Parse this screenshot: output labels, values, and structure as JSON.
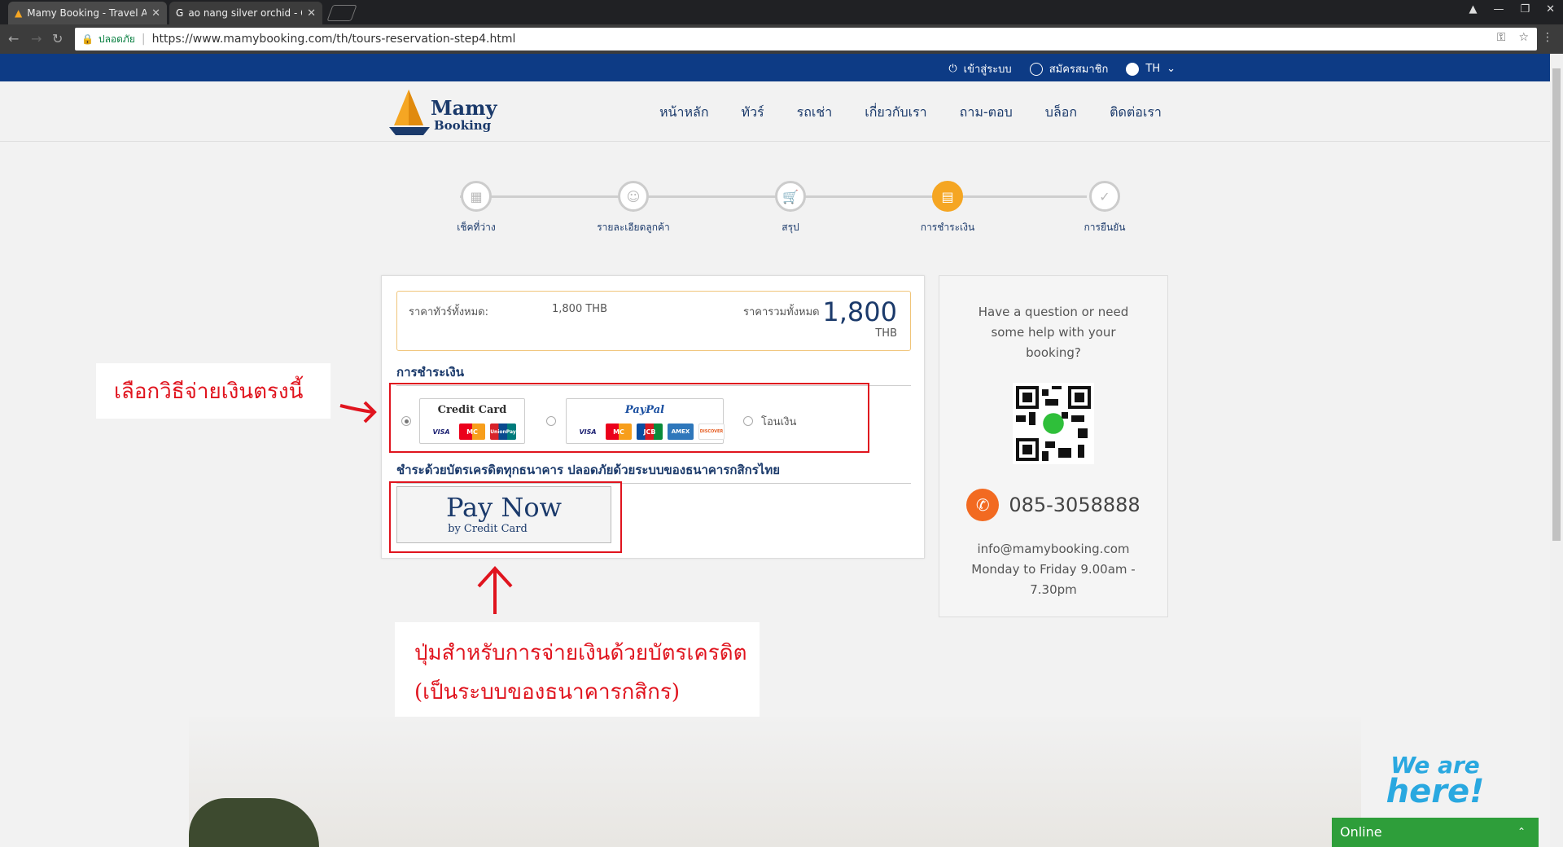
{
  "browser": {
    "tabs": [
      {
        "title": "Mamy Booking - Travel A",
        "close": "✕"
      },
      {
        "title": "ao nang silver orchid - G",
        "close": "✕"
      }
    ],
    "secure_label": "ปลอดภัย",
    "url": "https://www.mamybooking.com/th/tours-reservation-step4.html"
  },
  "topbar": {
    "login": "เข้าสู่ระบบ",
    "register": "สมัครสมาชิก",
    "language": "TH"
  },
  "logo": {
    "line1": "Mamy",
    "line2": "Booking"
  },
  "nav": [
    "หน้าหลัก",
    "ทัวร์",
    "รถเช่า",
    "เกี่ยวกับเรา",
    "ถาม-ตอบ",
    "บล็อก",
    "ติดต่อเรา"
  ],
  "steps": [
    {
      "label": "เช็คที่ว่าง",
      "icon": "calendar-icon"
    },
    {
      "label": "รายละเอียดลูกค้า",
      "icon": "user-icon"
    },
    {
      "label": "สรุป",
      "icon": "cart-icon"
    },
    {
      "label": "การชำระเงิน",
      "icon": "payment-icon",
      "active": true
    },
    {
      "label": "การยืนยัน",
      "icon": "check-icon"
    }
  ],
  "price": {
    "tour_price_label": "ราคาทัวร์ทั้งหมด:",
    "tour_price_value": "1,800 THB",
    "total_label": "ราคารวมทั้งหมด",
    "total_value": "1,800",
    "currency": "THB"
  },
  "payment": {
    "section_title": "การชำระเงิน",
    "options": {
      "credit_card_title": "Credit Card",
      "paypal_title": "PayPal",
      "transfer_label": "โอนเงิน"
    },
    "credit_card_logos": [
      "VISA",
      "MC",
      "UnionPay"
    ],
    "paypal_logos": [
      "VISA",
      "MC",
      "JCB",
      "AMEX",
      "DISCOVER"
    ],
    "subsection_title": "ชำระด้วยบัตรเครดิตทุกธนาคาร ปลอดภัยด้วยระบบของธนาคารกสิกรไทย",
    "pay_now": "Pay Now",
    "pay_now_sub": "by Credit Card"
  },
  "help": {
    "question": "Have a question or need some help with your booking?",
    "phone": "085-3058888",
    "email": "info@mamybooking.com",
    "hours": "Monday to Friday 9.00am - 7.30pm"
  },
  "annotations": {
    "choose_method": "เลือกวิธีจ่ายเงินตรงนี้",
    "button_note_line1": "ปุ่มสำหรับการจ่ายเงินด้วยบัตรเครดิต",
    "button_note_line2": "(เป็นระบบของธนาคารกสิกร)"
  },
  "chat": {
    "badge_line1": "We are",
    "badge_line2": "here!",
    "status": "Online"
  },
  "colors": {
    "brand_blue": "#0d3b85",
    "accent_orange": "#f5a623",
    "annotation_red": "#e0141e",
    "online_green": "#2e9e3a"
  }
}
